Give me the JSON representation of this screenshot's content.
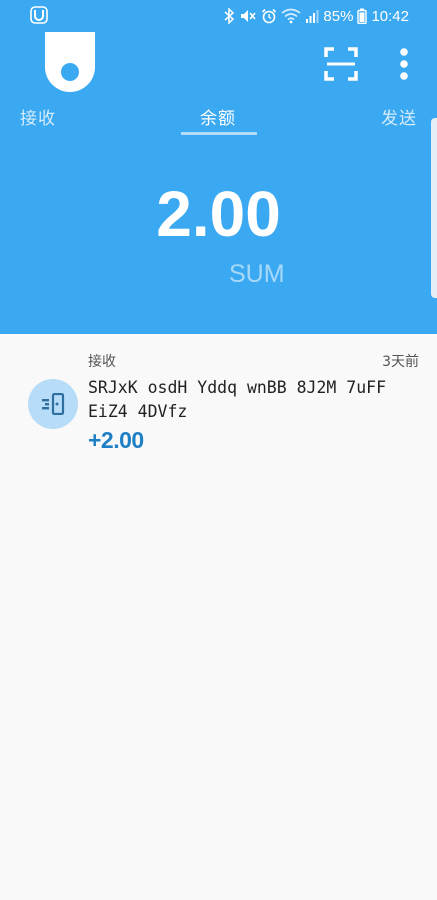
{
  "status_bar": {
    "battery": "85%",
    "time": "10:42",
    "icons": [
      "bluetooth-icon",
      "mute-icon",
      "alarm-icon",
      "wifi-icon",
      "signal-icon",
      "battery-icon"
    ]
  },
  "header": {
    "logo_icon": "wallet-logo-icon",
    "scan_icon": "scan-icon",
    "menu_icon": "more-vertical-icon",
    "tabs": [
      {
        "label": "接收",
        "active": false
      },
      {
        "label": "余额",
        "active": true
      },
      {
        "label": "发送",
        "active": false
      }
    ],
    "balance": "2.00",
    "currency": "SUM"
  },
  "colors": {
    "primary": "#3ba9f2",
    "amount_positive": "#1f7fc4",
    "avatar_bg": "#b7dcf7",
    "background": "#f9f9f9"
  },
  "transactions": [
    {
      "type": "接收",
      "time": "3天前",
      "address": "SRJxK osdH Yddq wnBB 8J2M 7uFF EiZ4 4DVfz",
      "amount": "+2.00",
      "icon": "receive-icon"
    }
  ]
}
